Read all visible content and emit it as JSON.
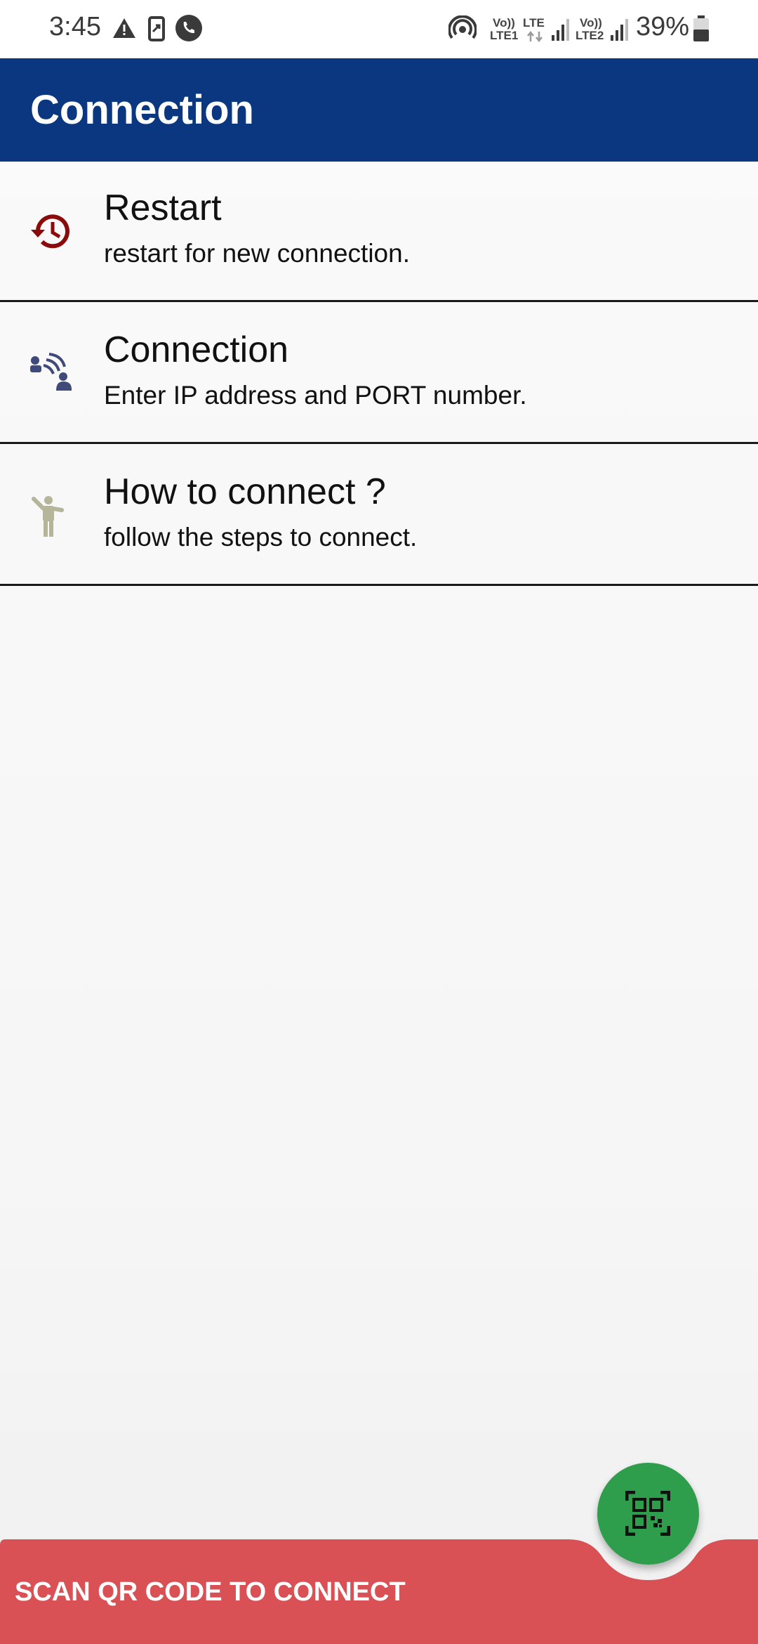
{
  "status_bar": {
    "time": "3:45",
    "net1_top": "Vo))",
    "net1_bottom": "LTE1",
    "net_mid_top": "LTE",
    "net2_top": "Vo))",
    "net2_bottom": "LTE2",
    "battery": "39%",
    "icons": [
      "warning-icon",
      "screen-share-icon",
      "phone-icon",
      "hotspot-icon",
      "signal-icon",
      "signal-icon",
      "battery-icon"
    ]
  },
  "app_bar": {
    "title": "Connection"
  },
  "menu": [
    {
      "title": "Restart",
      "subtitle": "restart for new connection.",
      "icon": "history-icon",
      "icon_color": "#8b0a0a"
    },
    {
      "title": "Connection",
      "subtitle": "Enter IP address and PORT number.",
      "icon": "wireless-people-icon",
      "icon_color": "#3f4a7a"
    },
    {
      "title": "How to connect ?",
      "subtitle": "follow the steps to connect.",
      "icon": "person-waving-icon",
      "icon_color": "#b5b59a"
    }
  ],
  "bottom_bar": {
    "label": "SCAN QR CODE TO CONNECT",
    "color": "#d95154"
  },
  "fab": {
    "icon": "qr-scan-icon",
    "color": "#2e9e4c"
  }
}
